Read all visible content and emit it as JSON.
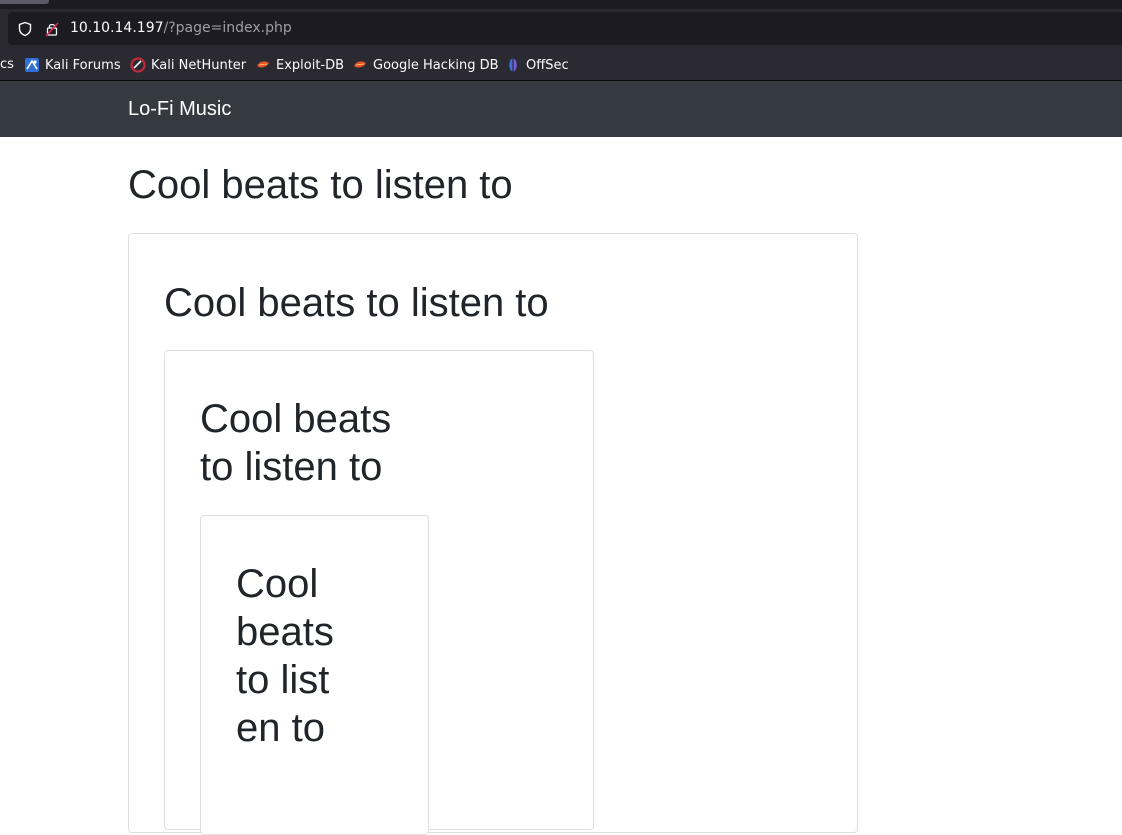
{
  "browser": {
    "url_host": "10.10.14.197",
    "url_path": "/?page=index.php",
    "bookmarks": [
      {
        "label": "cs",
        "icon": "truncated"
      },
      {
        "label": "Kali Forums",
        "icon": "kali-forums-icon"
      },
      {
        "label": "Kali NetHunter",
        "icon": "kali-nethunter-icon"
      },
      {
        "label": "Exploit-DB",
        "icon": "exploit-db-icon"
      },
      {
        "label": "Google Hacking DB",
        "icon": "google-hacking-db-icon"
      },
      {
        "label": "OffSec",
        "icon": "offsec-icon"
      }
    ]
  },
  "navbar": {
    "brand": "Lo-Fi Music"
  },
  "page": {
    "heading_1": "Cool beats to listen to",
    "heading_2": "Cool beats to listen to",
    "heading_3": "Cool beats to listen to",
    "heading_4": "Cool beats to listen to"
  },
  "colors": {
    "navbar_bg": "#343a40",
    "chrome_bg": "#2b2a33",
    "urlbar_bg": "#1c1b22",
    "text": "#212529"
  }
}
